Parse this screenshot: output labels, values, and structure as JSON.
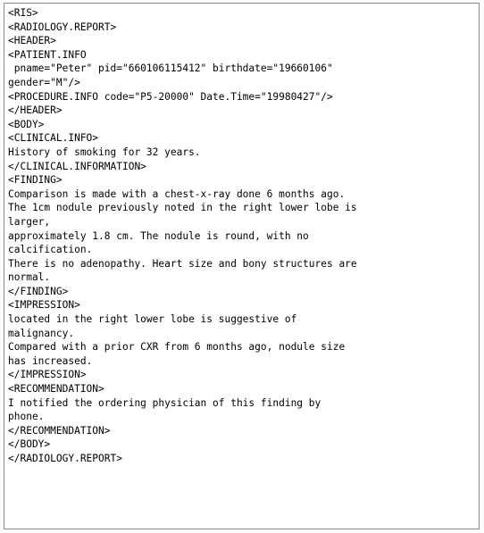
{
  "document": {
    "lines": [
      "<RIS>",
      "<RADIOLOGY.REPORT>",
      "<HEADER>",
      "<PATIENT.INFO",
      " pname=\"Peter\" pid=\"660106115412\" birthdate=\"19660106\"",
      "gender=\"M\"/>",
      "<PROCEDURE.INFO code=\"P5-20000\" Date.Time=\"19980427\"/>",
      "</HEADER>",
      "<BODY>",
      "<CLINICAL.INFO>",
      "History of smoking for 32 years.",
      "</CLINICAL.INFORMATION>",
      "<FINDING>",
      "Comparison is made with a chest-x-ray done 6 months ago.",
      "The 1cm nodule previously noted in the right lower lobe is",
      "larger,",
      "approximately 1.8 cm. The nodule is round, with no",
      "calcification.",
      "There is no adenopathy. Heart size and bony structures are",
      "normal.",
      "</FINDING>",
      "<IMPRESSION>",
      "located in the right lower lobe is suggestive of",
      "malignancy.",
      "Compared with a prior CXR from 6 months ago, nodule size",
      "has increased.",
      "</IMPRESSION>",
      "<RECOMMENDATION>",
      "I notified the ordering physician of this finding by",
      "phone.",
      "</RECOMMENDATION>",
      "</BODY>",
      "</RADIOLOGY.REPORT>"
    ]
  }
}
